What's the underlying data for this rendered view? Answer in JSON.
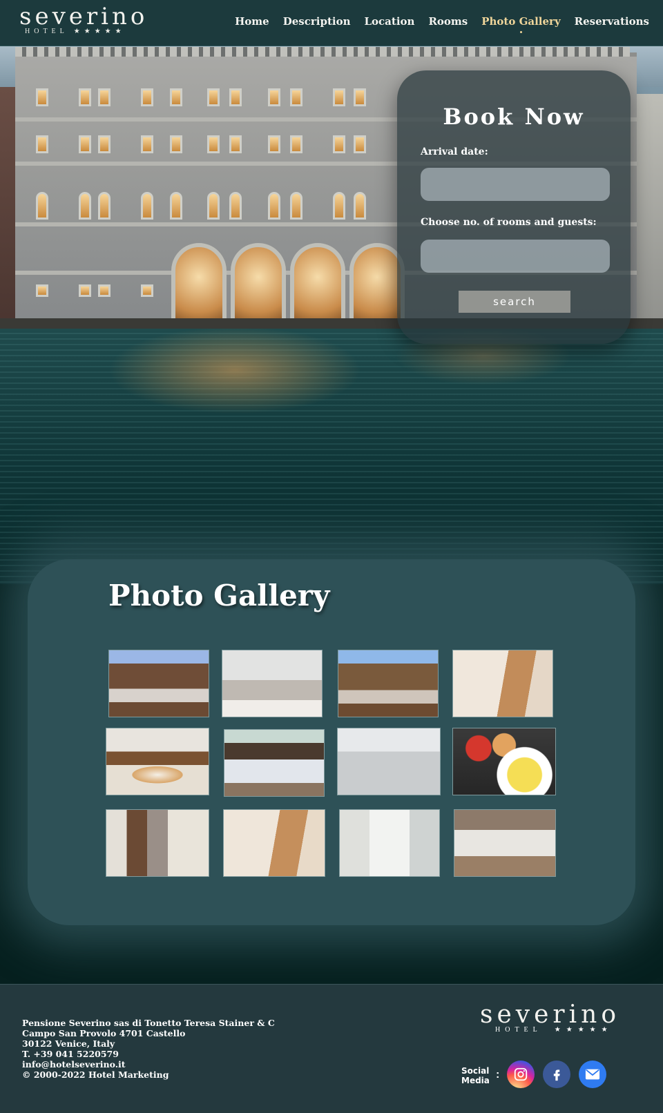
{
  "brand": {
    "name": "severino",
    "sub": "HOTEL",
    "stars": "★★★★★"
  },
  "nav": [
    {
      "label": "Home"
    },
    {
      "label": "Description"
    },
    {
      "label": "Location"
    },
    {
      "label": "Rooms"
    },
    {
      "label": "Photo Gallery",
      "active": true
    },
    {
      "label": "Reservations"
    }
  ],
  "booking": {
    "title": "Book Now",
    "arrival_label": "Arrival date:",
    "arrival_value": "",
    "rooms_label": "Choose no. of rooms and guests:",
    "rooms_value": "",
    "search_label": "search"
  },
  "gallery": {
    "title": "Photo Gallery",
    "images": [
      "double-room",
      "twin-room",
      "double-room-2",
      "breakfast-buffet",
      "breakfast-hall",
      "bar-counter",
      "conference-room",
      "breakfast-plate",
      "corridor",
      "breakfast-buffet-2",
      "bathroom-shower",
      "dining-room"
    ]
  },
  "footer": {
    "company": "Pensione Severino sas di Tonetto Teresa Stainer & C",
    "street": "Campo San Provolo 4701 Castello",
    "city": "30122 Venice, Italy",
    "phone": "T. +39 041 5220579",
    "email": "info@hotelseverino.it",
    "copyright": "© 2000-2022 Hotel Marketing",
    "social_label_1": "Social",
    "social_label_2": "Media",
    "colon": ":",
    "social": [
      "instagram-icon",
      "facebook-icon",
      "mail-icon"
    ]
  },
  "colors": {
    "nav_bg": "#1c3a3d",
    "accent": "#efd59a",
    "gallery_bg": "#2e5157",
    "footer_bg": "#24393e"
  }
}
